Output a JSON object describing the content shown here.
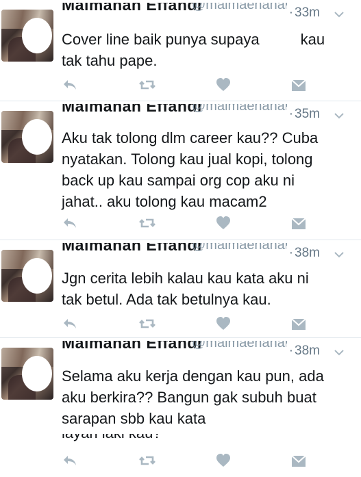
{
  "tweets": [
    {
      "name": "Maimanah Effandi",
      "handle": "@maimaenanai",
      "time": "33m",
      "lines": [
        "Cover line baik punya supaya",
        "tak tahu pape."
      ],
      "line1_tail": "kau"
    },
    {
      "name": "Maimanah Effandi",
      "handle": "@maimaenanai",
      "time": "35m",
      "lines": [
        "Aku tak tolong dlm career kau?? Cuba",
        "nyatakan. Tolong kau jual kopi, tolong",
        "back up kau sampai org cop aku ni",
        "jahat.. aku tolong kau macam2"
      ]
    },
    {
      "name": "Maimanah Effandi",
      "handle": "@maimaenanai",
      "time": "38m",
      "lines": [
        "Jgn cerita lebih kalau kau kata aku ni",
        "tak betul. Ada tak betulnya kau."
      ]
    },
    {
      "name": "Maimanah Effandi",
      "handle": "@maimaenanai",
      "time": "38m",
      "lines": [
        "Selama aku kerja dengan kau pun, ada",
        "aku berkira?? Bangun gak subuh buat",
        "sarapan sbb kau kata"
      ],
      "cut_line": "layan laki kau?"
    }
  ],
  "icons": {
    "reply": "reply-icon",
    "retweet": "retweet-icon",
    "like": "heart-icon",
    "dm": "envelope-icon",
    "more": "chevron-down-icon"
  },
  "colors": {
    "icon": "#aab8c2",
    "secondary_text": "#657786",
    "divider": "#e1e8ed"
  }
}
